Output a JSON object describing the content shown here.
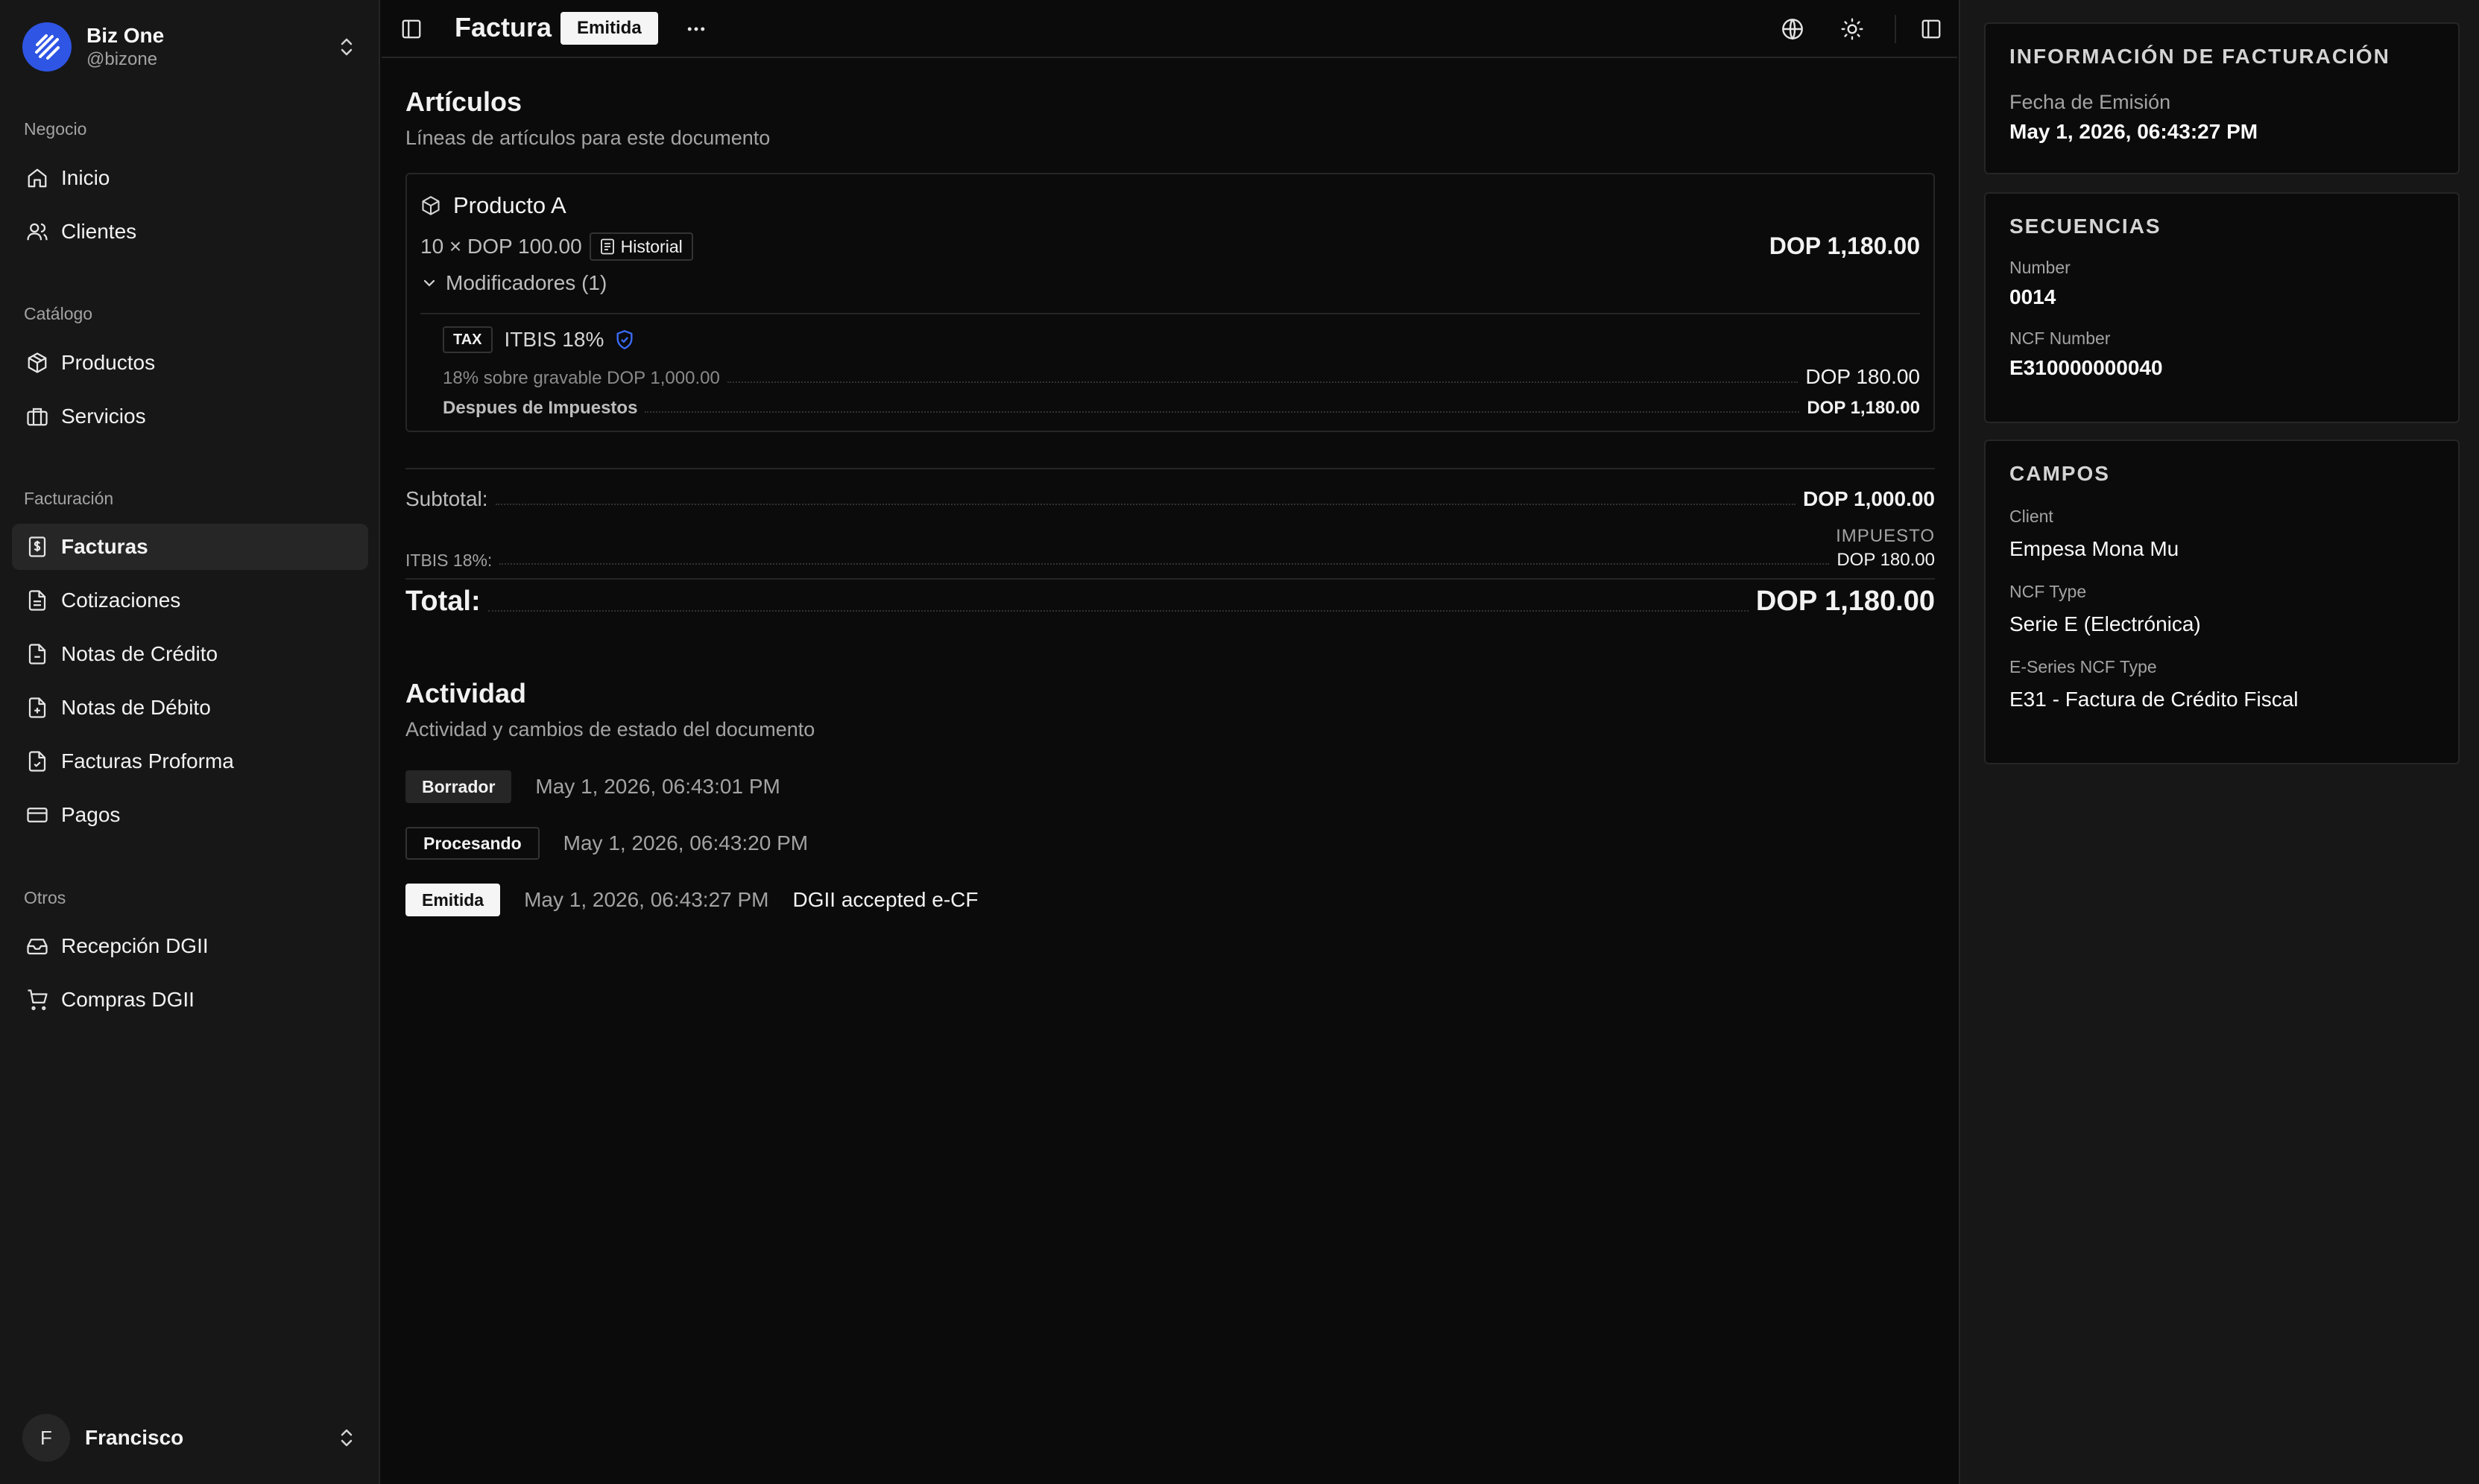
{
  "sidebar": {
    "org_name": "Biz One",
    "org_handle": "@bizone",
    "groups": [
      {
        "label": "Negocio",
        "items": [
          {
            "label": "Inicio",
            "icon": "home-icon"
          },
          {
            "label": "Clientes",
            "icon": "users-icon"
          }
        ]
      },
      {
        "label": "Catálogo",
        "items": [
          {
            "label": "Productos",
            "icon": "package-icon"
          },
          {
            "label": "Servicios",
            "icon": "briefcase-icon"
          }
        ]
      },
      {
        "label": "Facturación",
        "items": [
          {
            "label": "Facturas",
            "icon": "receipt-dollar-icon",
            "active": true
          },
          {
            "label": "Cotizaciones",
            "icon": "file-text-icon"
          },
          {
            "label": "Notas de Crédito",
            "icon": "file-minus-icon"
          },
          {
            "label": "Notas de Débito",
            "icon": "file-plus-icon"
          },
          {
            "label": "Facturas Proforma",
            "icon": "file-check-icon"
          },
          {
            "label": "Pagos",
            "icon": "credit-card-icon"
          }
        ]
      },
      {
        "label": "Otros",
        "items": [
          {
            "label": "Recepción DGII",
            "icon": "inbox-icon"
          },
          {
            "label": "Compras DGII",
            "icon": "cart-icon"
          }
        ]
      }
    ],
    "user_initial": "F",
    "user_name": "Francisco"
  },
  "header": {
    "title": "Factura",
    "status": "Emitida"
  },
  "articles": {
    "title": "Artículos",
    "subtitle": "Líneas de artículos para este documento",
    "item": {
      "name": "Producto A",
      "qty_price": "10 × DOP 100.00",
      "history_label": "Historial",
      "line_total": "DOP 1,180.00",
      "modifiers_label": "Modificadores (1)",
      "modifier": {
        "tag": "TAX",
        "name": "ITBIS 18%",
        "detail": "18% sobre gravable DOP 1,000.00",
        "amount": "DOP 180.00",
        "after_label": "Despues de Impuestos",
        "after_amount": "DOP 1,180.00"
      }
    }
  },
  "totals": {
    "subtotal_label": "Subtotal:",
    "subtotal_value": "DOP 1,000.00",
    "tax_header": "IMPUESTO",
    "tax_label": "ITBIS 18%:",
    "tax_value": "DOP 180.00",
    "total_label": "Total:",
    "total_value": "DOP 1,180.00"
  },
  "activity": {
    "title": "Actividad",
    "subtitle": "Actividad y cambios de estado del documento",
    "events": [
      {
        "status": "Borrador",
        "time": "May 1, 2026, 06:43:01 PM",
        "note": ""
      },
      {
        "status": "Procesando",
        "time": "May 1, 2026, 06:43:20 PM",
        "note": ""
      },
      {
        "status": "Emitida",
        "time": "May 1, 2026, 06:43:27 PM",
        "note": "DGII accepted e-CF"
      }
    ]
  },
  "right_panel": {
    "billing": {
      "title": "INFORMACIÓN DE FACTURACIÓN",
      "issue_date_label": "Fecha de Emisión",
      "issue_date_value": "May 1, 2026, 06:43:27 PM"
    },
    "sequences": {
      "title": "SECUENCIAS",
      "number_label": "Number",
      "number_value": "0014",
      "ncf_label": "NCF Number",
      "ncf_value": "E310000000040"
    },
    "fields": {
      "title": "CAMPOS",
      "client_label": "Client",
      "client_value": "Empesa Mona Mu",
      "ncf_type_label": "NCF Type",
      "ncf_type_value": "Serie E (Electrónica)",
      "eseries_label": "E-Series NCF Type",
      "eseries_value": "E31 - Factura de Crédito Fiscal"
    }
  },
  "colors": {
    "accent": "#2f55e4",
    "background": "#0b0b0c",
    "panel": "#171717",
    "border": "#262626"
  }
}
